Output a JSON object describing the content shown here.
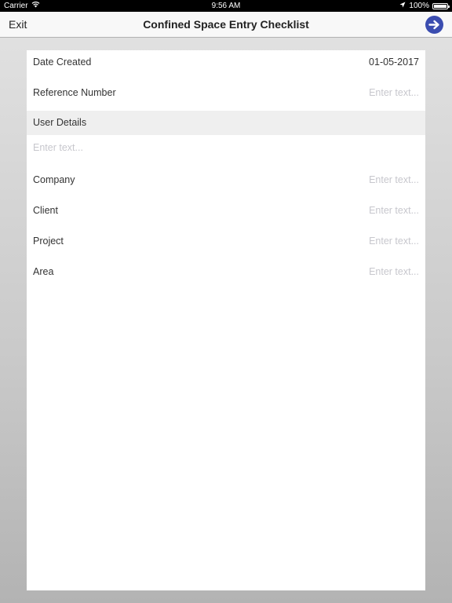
{
  "status_bar": {
    "carrier": "Carrier",
    "time": "9:56 AM",
    "battery_percent": "100%",
    "battery_level": 1.0,
    "icons": [
      "wifi-icon",
      "location-arrow-icon",
      "battery-icon"
    ]
  },
  "nav": {
    "exit_label": "Exit",
    "title": "Confined Space Entry Checklist",
    "next_icon": "arrow-right-circle-icon",
    "accent_color": "#3b4db0"
  },
  "form": {
    "date_created": {
      "label": "Date Created",
      "value": "01-05-2017"
    },
    "reference_number": {
      "label": "Reference Number",
      "placeholder": "Enter text..."
    },
    "user_details": {
      "header": "User Details",
      "placeholder": "Enter text..."
    },
    "company": {
      "label": "Company",
      "placeholder": "Enter text..."
    },
    "client": {
      "label": "Client",
      "placeholder": "Enter text..."
    },
    "project": {
      "label": "Project",
      "placeholder": "Enter text..."
    },
    "area": {
      "label": "Area",
      "placeholder": "Enter text..."
    }
  }
}
